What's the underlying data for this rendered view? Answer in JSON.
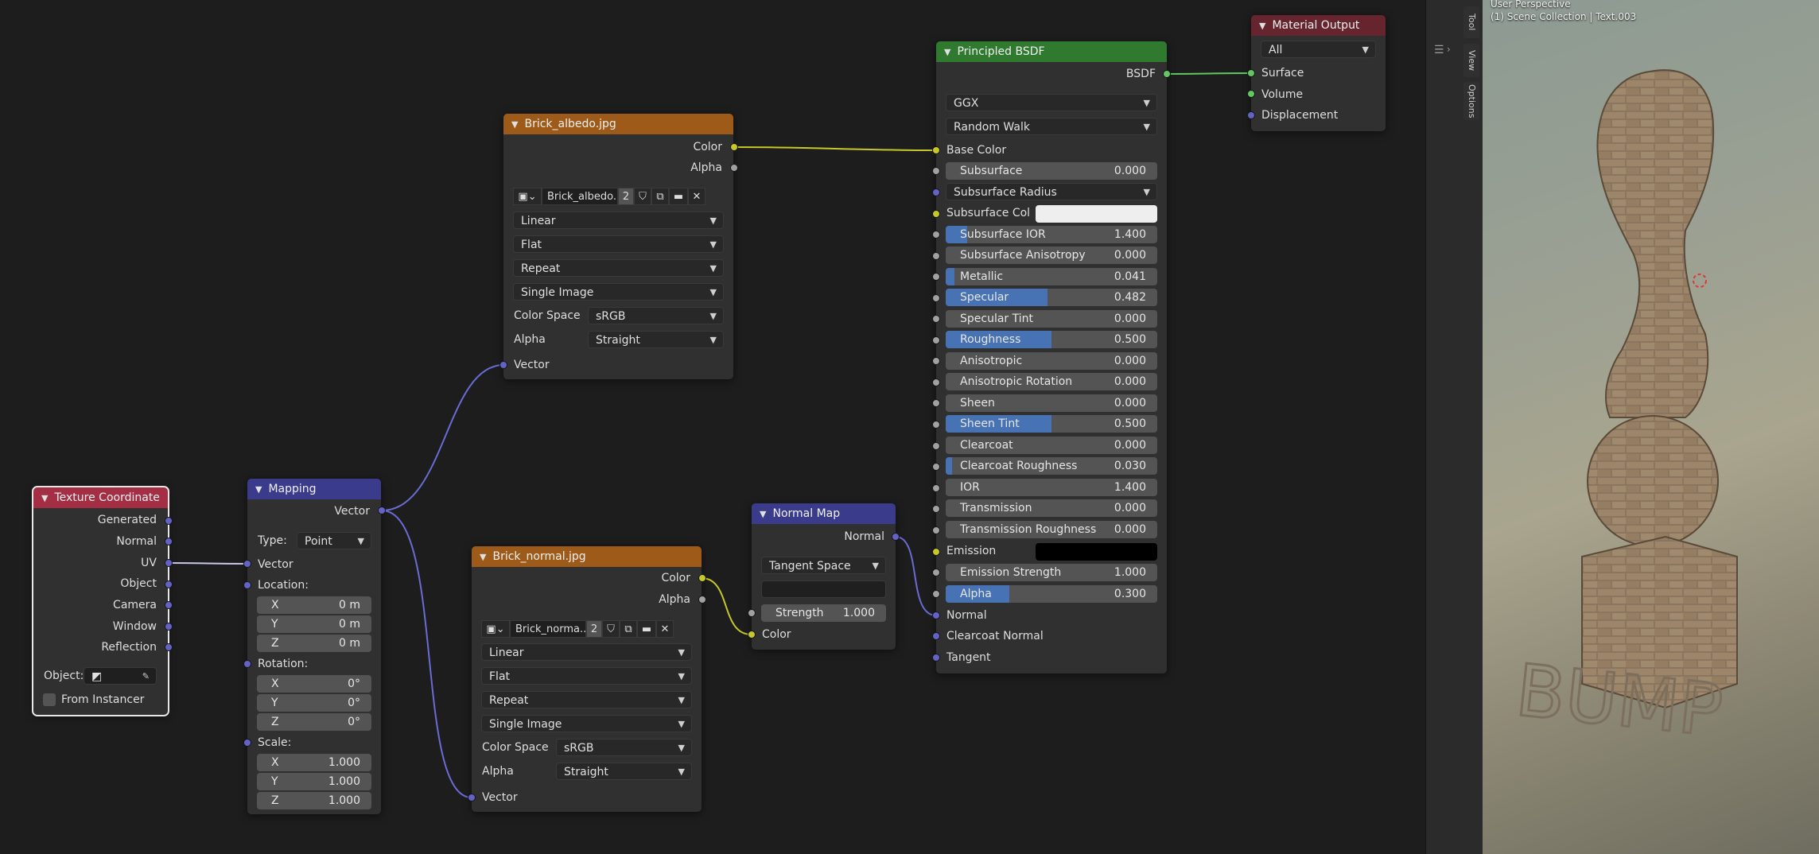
{
  "colors": {
    "header_texture": "#a42f45",
    "header_vector": "#3b3b8c",
    "header_image": "#9d5a18",
    "header_shader": "#2f7a2f",
    "header_output": "#66242f",
    "socket_color": "#c7c729",
    "socket_float": "#a1a1a1",
    "socket_vector": "#6363c7",
    "socket_shader": "#63c763",
    "slider_fill": "#4772b3"
  },
  "nodes": {
    "tex_coord": {
      "title": "Texture Coordinate",
      "outputs": [
        "Generated",
        "Normal",
        "UV",
        "Object",
        "Camera",
        "Window",
        "Reflection"
      ],
      "object_label": "Object:",
      "from_instancer": "From Instancer"
    },
    "mapping": {
      "title": "Mapping",
      "output": "Vector",
      "type_label": "Type:",
      "type_value": "Point",
      "input_vector": "Vector",
      "location_label": "Location:",
      "location": [
        {
          "axis": "X",
          "value": "0 m"
        },
        {
          "axis": "Y",
          "value": "0 m"
        },
        {
          "axis": "Z",
          "value": "0 m"
        }
      ],
      "rotation_label": "Rotation:",
      "rotation": [
        {
          "axis": "X",
          "value": "0°"
        },
        {
          "axis": "Y",
          "value": "0°"
        },
        {
          "axis": "Z",
          "value": "0°"
        }
      ],
      "scale_label": "Scale:",
      "scale": [
        {
          "axis": "X",
          "value": "1.000"
        },
        {
          "axis": "Y",
          "value": "1.000"
        },
        {
          "axis": "Z",
          "value": "1.000"
        }
      ]
    },
    "albedo": {
      "title": "Brick_albedo.jpg",
      "out_color": "Color",
      "out_alpha": "Alpha",
      "image_name": "Brick_albedo...",
      "users": "2",
      "interpolation": "Linear",
      "projection": "Flat",
      "extension": "Repeat",
      "source": "Single Image",
      "colorspace_label": "Color Space",
      "colorspace": "sRGB",
      "alpha_label": "Alpha",
      "alpha_mode": "Straight",
      "input_vector": "Vector"
    },
    "normal_img": {
      "title": "Brick_normal.jpg",
      "out_color": "Color",
      "out_alpha": "Alpha",
      "image_name": "Brick_norma...",
      "users": "2",
      "interpolation": "Linear",
      "projection": "Flat",
      "extension": "Repeat",
      "source": "Single Image",
      "colorspace_label": "Color Space",
      "colorspace": "sRGB",
      "alpha_label": "Alpha",
      "alpha_mode": "Straight",
      "input_vector": "Vector"
    },
    "normal_map": {
      "title": "Normal Map",
      "output": "Normal",
      "space": "Tangent Space",
      "strength_label": "Strength",
      "strength": "1.000",
      "input_color": "Color"
    },
    "bsdf": {
      "title": "Principled BSDF",
      "output": "BSDF",
      "distribution": "GGX",
      "subsurface_method": "Random Walk",
      "base_color": "Base Color",
      "subsurface_radius": "Subsurface Radius",
      "subsurface_color": "Subsurface Col",
      "emission": "Emission",
      "normal": "Normal",
      "clearcoat_normal": "Clearcoat Normal",
      "tangent": "Tangent",
      "sliders": [
        {
          "label": "Subsurface",
          "value": "0.000",
          "fill": 0
        },
        {
          "label": "Subsurface IOR",
          "value": "1.400",
          "fill": 0.1
        },
        {
          "label": "Subsurface Anisotropy",
          "value": "0.000",
          "fill": 0
        },
        {
          "label": "Metallic",
          "value": "0.041",
          "fill": 0.041
        },
        {
          "label": "Specular",
          "value": "0.482",
          "fill": 0.482
        },
        {
          "label": "Specular Tint",
          "value": "0.000",
          "fill": 0
        },
        {
          "label": "Roughness",
          "value": "0.500",
          "fill": 0.5
        },
        {
          "label": "Anisotropic",
          "value": "0.000",
          "fill": 0
        },
        {
          "label": "Anisotropic Rotation",
          "value": "0.000",
          "fill": 0
        },
        {
          "label": "Sheen",
          "value": "0.000",
          "fill": 0
        },
        {
          "label": "Sheen Tint",
          "value": "0.500",
          "fill": 0.5
        },
        {
          "label": "Clearcoat",
          "value": "0.000",
          "fill": 0
        },
        {
          "label": "Clearcoat Roughness",
          "value": "0.030",
          "fill": 0.03
        },
        {
          "label": "IOR",
          "value": "1.400",
          "fill": 0
        },
        {
          "label": "Transmission",
          "value": "0.000",
          "fill": 0
        },
        {
          "label": "Transmission Roughness",
          "value": "0.000",
          "fill": 0
        },
        {
          "label": "Emission Strength",
          "value": "1.000",
          "fill": 0
        },
        {
          "label": "Alpha",
          "value": "0.300",
          "fill": 0.3
        }
      ]
    },
    "output": {
      "title": "Material Output",
      "target": "All",
      "inputs": [
        "Surface",
        "Volume",
        "Displacement"
      ]
    }
  },
  "sidebar": {
    "tabs": [
      "Tool",
      "View",
      "Options"
    ]
  },
  "viewport": {
    "perspective": "User Perspective",
    "collection": "(1) Scene Collection | Text.003",
    "model_text": "BUMP"
  }
}
